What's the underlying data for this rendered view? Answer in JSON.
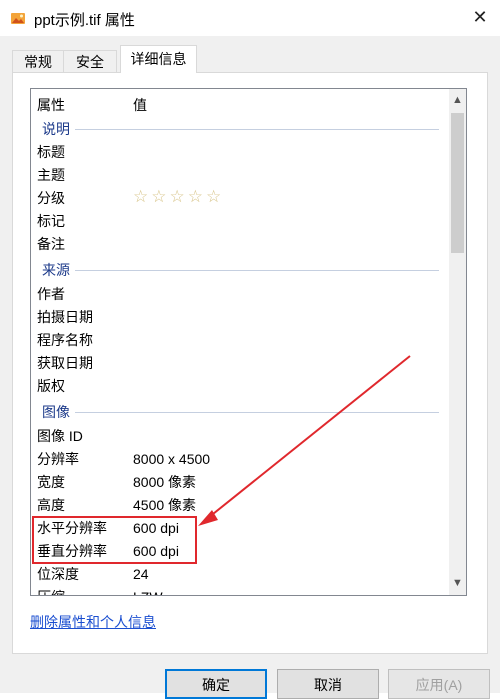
{
  "window": {
    "title": "ppt示例.tif 属性",
    "close_glyph": "✕"
  },
  "tabs": [
    {
      "label": "常规"
    },
    {
      "label": "安全"
    },
    {
      "label": "详细信息"
    }
  ],
  "details": {
    "header_property": "属性",
    "header_value": "值",
    "groups": {
      "description": "说明",
      "origin": "来源",
      "image": "图像"
    },
    "description_rows": [
      {
        "label": "标题",
        "value": ""
      },
      {
        "label": "主题",
        "value": ""
      },
      {
        "label": "分级",
        "value": "☆☆☆☆☆"
      },
      {
        "label": "标记",
        "value": ""
      },
      {
        "label": "备注",
        "value": ""
      }
    ],
    "origin_rows": [
      {
        "label": "作者",
        "value": ""
      },
      {
        "label": "拍摄日期",
        "value": ""
      },
      {
        "label": "程序名称",
        "value": ""
      },
      {
        "label": "获取日期",
        "value": ""
      },
      {
        "label": "版权",
        "value": ""
      }
    ],
    "image_rows": [
      {
        "label": "图像 ID",
        "value": ""
      },
      {
        "label": "分辨率",
        "value": "8000 x 4500"
      },
      {
        "label": "宽度",
        "value": "8000 像素"
      },
      {
        "label": "高度",
        "value": "4500 像素"
      },
      {
        "label": "水平分辨率",
        "value": "600 dpi"
      },
      {
        "label": "垂直分辨率",
        "value": "600 dpi"
      },
      {
        "label": "位深度",
        "value": "24"
      },
      {
        "label": "压缩",
        "value": "LZW"
      }
    ]
  },
  "remove_link": "删除属性和个人信息",
  "buttons": {
    "ok": "确定",
    "cancel": "取消",
    "apply": "应用(A)"
  },
  "colors": {
    "highlight_box": "#e0282d",
    "group_label": "#1c3a8a",
    "link": "#1a4ed0"
  }
}
